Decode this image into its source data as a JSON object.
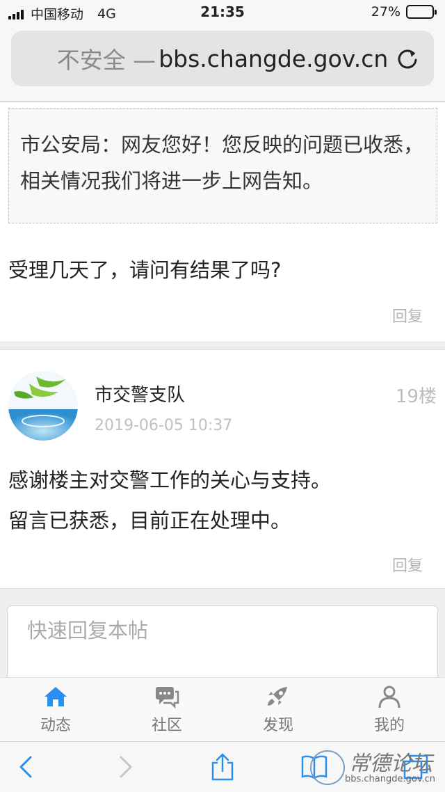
{
  "status_bar": {
    "carrier": "中国移动",
    "network": "4G",
    "time": "21:35",
    "battery": "27%"
  },
  "browser": {
    "insecure_label": "不安全 —",
    "domain": "bbs.changde.gov.cn"
  },
  "post_prev": {
    "quote": "市公安局：网友您好！您反映的问题已收悉，相关情况我们将进一步上网告知。",
    "reply": "受理几天了，请问有结果了吗?",
    "reply_link": "回复"
  },
  "post_19": {
    "author": "市交警支队",
    "floor": "19楼",
    "date": "2019-06-05 10:37",
    "lines": [
      "感谢楼主对交警工作的关心与支持。",
      "留言已获悉，目前正在处理中。"
    ],
    "reply_link": "回复"
  },
  "quick_reply": {
    "placeholder": "快速回复本帖"
  },
  "tabs": [
    {
      "label": "动态",
      "icon": "home-icon"
    },
    {
      "label": "社区",
      "icon": "chat-icon"
    },
    {
      "label": "发现",
      "icon": "rocket-icon"
    },
    {
      "label": "我的",
      "icon": "person-icon"
    }
  ],
  "watermark": {
    "text": "常德论坛",
    "url": "bbs.changde.gov.cn"
  },
  "colors": {
    "accent": "#2a8ff0",
    "muted": "#b5b5b5"
  }
}
